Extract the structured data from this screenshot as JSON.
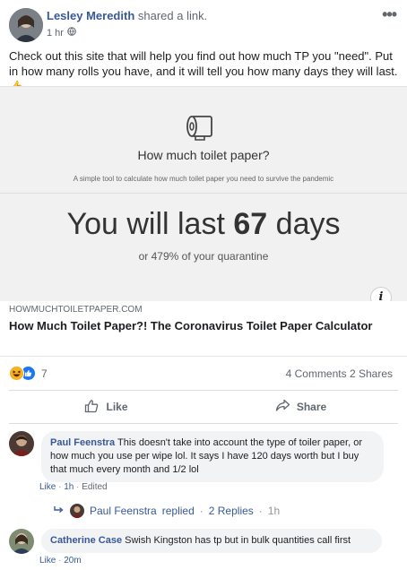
{
  "post": {
    "author": "Lesley Meredith",
    "action": "shared a link.",
    "time": "1 hr",
    "more_icon": "more-horizontal-icon",
    "text": "Check out this site that will help you find out how much TP you \"need\". Put in how many rolls you have, and it will tell you how many days they will last. 👍"
  },
  "link": {
    "tool_title": "How much toilet paper?",
    "tool_subtitle": "A simple tool to calculate how much toilet paper you need to survive the pandemic",
    "result_prefix": "You will last",
    "result_days": "67",
    "result_suffix": "days",
    "quarantine_prefix": "or",
    "quarantine_percent": "479%",
    "quarantine_suffix": "of your quarantine",
    "info_label": "i",
    "domain": "HOWMUCHTOILETPAPER.COM",
    "title": "How Much Toilet Paper?! The Coronavirus Toilet Paper Calculator"
  },
  "reactions": {
    "count": "7",
    "comments": "4 Comments",
    "shares": "2 Shares",
    "icons": [
      "haha-reaction-icon",
      "like-reaction-icon"
    ]
  },
  "actions": {
    "like_label": "Like",
    "share_label": "Share"
  },
  "comments": [
    {
      "author": "Paul Feenstra",
      "text": "This doesn't take into account the type of toiler paper, or how much you use per wipe lol. It says I have 120 days worth but I buy that much every month and 1/2 lol",
      "like": "Like",
      "time": "1h",
      "edited": "Edited"
    },
    {
      "author": "Catherine Case",
      "text": "Swish Kingston has tp but in bulk quantities call first",
      "like": "Like",
      "time": "20m"
    }
  ],
  "replies": {
    "author": "Paul Feenstra",
    "replied": "replied",
    "count": "2 Replies",
    "time": "1h"
  },
  "colors": {
    "link_blue": "#385898",
    "like_blue": "#1877f2",
    "muted_text": "#606770",
    "preview_bg": "#f1f1f1"
  }
}
